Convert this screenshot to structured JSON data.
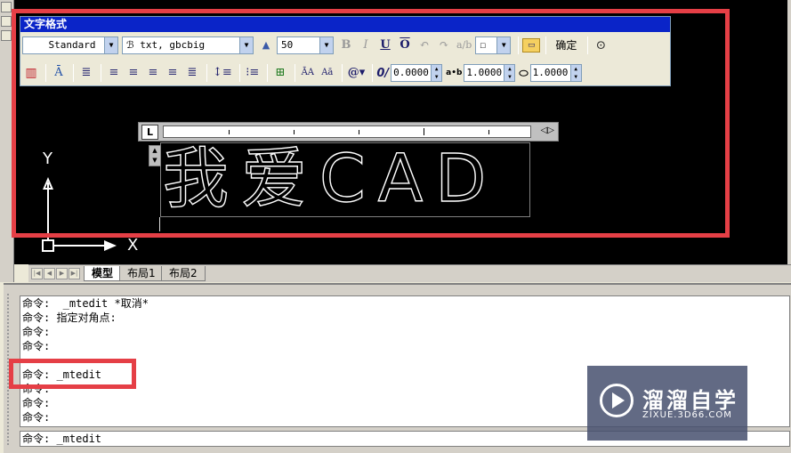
{
  "toolbar": {
    "title": "文字格式",
    "style_value": "Standard",
    "font_value": "txt, gbcbig",
    "height_value": "50",
    "bold": "B",
    "italic": "I",
    "underline": "U",
    "overline": "O",
    "ok_label": "确定",
    "oblique_value": "0.0000",
    "tracking_value": "1.0000",
    "width_value": "1.0000",
    "tracking_label": "a•b",
    "oblique_label": "0/",
    "case_upper": "ĀA",
    "case_lower": "Aā",
    "symbol": "@▾"
  },
  "editor": {
    "text": "我爱CAD"
  },
  "ucs": {
    "y_label": "Y",
    "x_label": "X"
  },
  "tabs": {
    "model": "模型",
    "layout1": "布局1",
    "layout2": "布局2"
  },
  "command": {
    "history": [
      "命令:  _mtedit *取消*",
      "命令: 指定对角点:",
      "命令:",
      "命令:",
      "",
      "命令: _mtedit",
      "命令:",
      "命令:",
      "命令:"
    ],
    "input": "命令: _mtedit"
  },
  "watermark": {
    "title": "溜溜自学",
    "url": "ZIXUE.3D66.COM"
  },
  "colors": {
    "highlight": "#e53f46",
    "title_bar": "#0a24c8",
    "drawing_bg": "#000000"
  }
}
